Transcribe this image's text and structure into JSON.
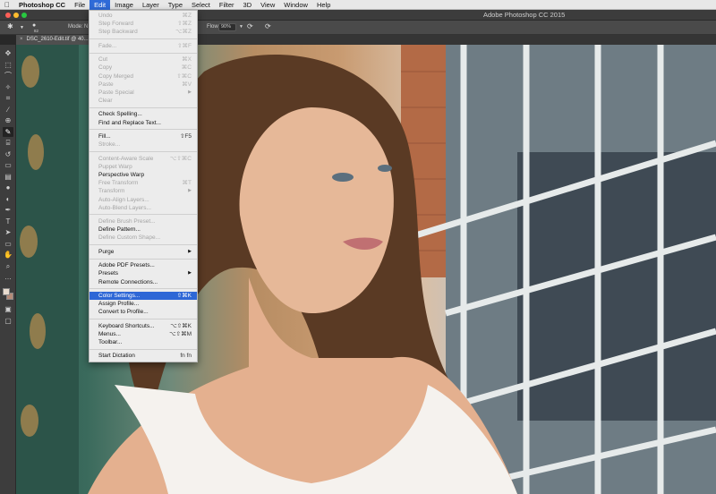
{
  "menubar": {
    "apple_icon": "apple-icon",
    "app": "Photoshop CC",
    "items": [
      "File",
      "Edit",
      "Image",
      "Layer",
      "Type",
      "Select",
      "Filter",
      "3D",
      "View",
      "Window",
      "Help"
    ],
    "active": "Edit"
  },
  "window": {
    "title": "Adobe Photoshop CC 2015",
    "lights": [
      "#fc5f57",
      "#fdbc2e",
      "#28c840"
    ]
  },
  "options": {
    "mode_label": "Mode:",
    "mode_value": "N",
    "flow_label": "Flow:",
    "flow_value": "90%",
    "brush_size": "82"
  },
  "document": {
    "tab_title": "DSC_2610-Edit.tif @ 40...",
    "close_icon": "close-icon"
  },
  "edit_menu": {
    "groups": [
      [
        {
          "label": "Undo",
          "shortcut": "⌘Z",
          "enabled": false
        },
        {
          "label": "Step Forward",
          "shortcut": "⇧⌘Z",
          "enabled": false
        },
        {
          "label": "Step Backward",
          "shortcut": "⌥⌘Z",
          "enabled": false
        }
      ],
      [
        {
          "label": "Fade...",
          "shortcut": "⇧⌘F",
          "enabled": false
        }
      ],
      [
        {
          "label": "Cut",
          "shortcut": "⌘X",
          "enabled": false
        },
        {
          "label": "Copy",
          "shortcut": "⌘C",
          "enabled": false
        },
        {
          "label": "Copy Merged",
          "shortcut": "⇧⌘C",
          "enabled": false
        },
        {
          "label": "Paste",
          "shortcut": "⌘V",
          "enabled": false
        },
        {
          "label": "Paste Special",
          "submenu": true,
          "enabled": false
        },
        {
          "label": "Clear",
          "enabled": false
        }
      ],
      [
        {
          "label": "Check Spelling...",
          "enabled": true
        },
        {
          "label": "Find and Replace Text...",
          "enabled": true
        }
      ],
      [
        {
          "label": "Fill...",
          "shortcut": "⇧F5",
          "enabled": true
        },
        {
          "label": "Stroke...",
          "enabled": false
        }
      ],
      [
        {
          "label": "Content-Aware Scale",
          "shortcut": "⌥⇧⌘C",
          "enabled": false
        },
        {
          "label": "Puppet Warp",
          "enabled": false
        },
        {
          "label": "Perspective Warp",
          "enabled": true
        },
        {
          "label": "Free Transform",
          "shortcut": "⌘T",
          "enabled": false
        },
        {
          "label": "Transform",
          "submenu": true,
          "enabled": false
        },
        {
          "label": "Auto-Align Layers...",
          "enabled": false
        },
        {
          "label": "Auto-Blend Layers...",
          "enabled": false
        }
      ],
      [
        {
          "label": "Define Brush Preset...",
          "enabled": false
        },
        {
          "label": "Define Pattern...",
          "enabled": true
        },
        {
          "label": "Define Custom Shape...",
          "enabled": false
        }
      ],
      [
        {
          "label": "Purge",
          "submenu": true,
          "enabled": true
        }
      ],
      [
        {
          "label": "Adobe PDF Presets...",
          "enabled": true
        },
        {
          "label": "Presets",
          "submenu": true,
          "enabled": true
        },
        {
          "label": "Remote Connections...",
          "enabled": true
        }
      ],
      [
        {
          "label": "Color Settings...",
          "shortcut": "⇧⌘K",
          "enabled": true,
          "highlighted": true
        },
        {
          "label": "Assign Profile...",
          "enabled": true
        },
        {
          "label": "Convert to Profile...",
          "enabled": true
        }
      ],
      [
        {
          "label": "Keyboard Shortcuts...",
          "shortcut": "⌥⇧⌘K",
          "enabled": true
        },
        {
          "label": "Menus...",
          "shortcut": "⌥⇧⌘M",
          "enabled": true
        },
        {
          "label": "Toolbar...",
          "enabled": true
        }
      ],
      [
        {
          "label": "Start Dictation",
          "shortcut": "fn fn",
          "enabled": true
        }
      ]
    ]
  },
  "toolbox": {
    "tools": [
      "move-tool-icon",
      "marquee-tool-icon",
      "lasso-tool-icon",
      "magic-wand-icon",
      "crop-tool-icon",
      "eyedropper-icon",
      "healing-brush-icon",
      "brush-tool-icon",
      "clone-stamp-icon",
      "history-brush-icon",
      "eraser-icon",
      "gradient-tool-icon",
      "blur-tool-icon",
      "dodge-tool-icon",
      "pen-tool-icon",
      "type-tool-icon",
      "path-selection-icon",
      "rectangle-tool-icon",
      "hand-tool-icon",
      "zoom-tool-icon",
      "more-tools-icon"
    ],
    "selected": "brush-tool-icon",
    "foreground_color": "#e9dccf",
    "background_color": "#b58b78"
  }
}
